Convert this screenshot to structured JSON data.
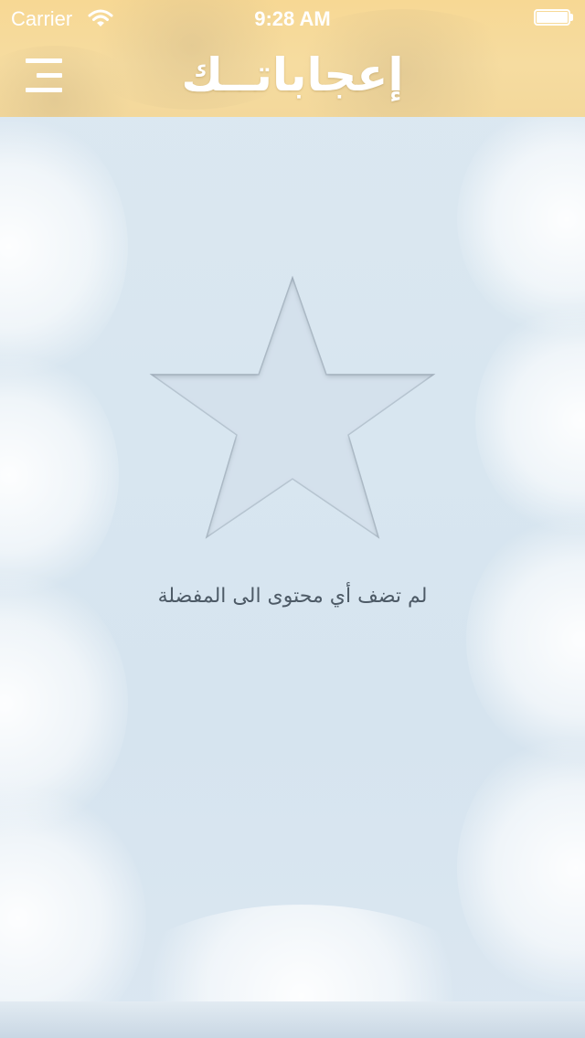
{
  "status_bar": {
    "carrier": "Carrier",
    "time": "9:28 AM",
    "wifi_icon": "wifi-icon",
    "battery_icon": "battery-icon",
    "battery_level": 1.0
  },
  "header": {
    "title": "إعجاباتــك",
    "menu_icon": "hamburger-menu-icon",
    "background_color": "#f6dca0"
  },
  "main": {
    "empty_state_icon": "star-icon",
    "empty_message": "لم تضف أي محتوى الى المفضلة",
    "background_color": "#d8e6f0"
  }
}
